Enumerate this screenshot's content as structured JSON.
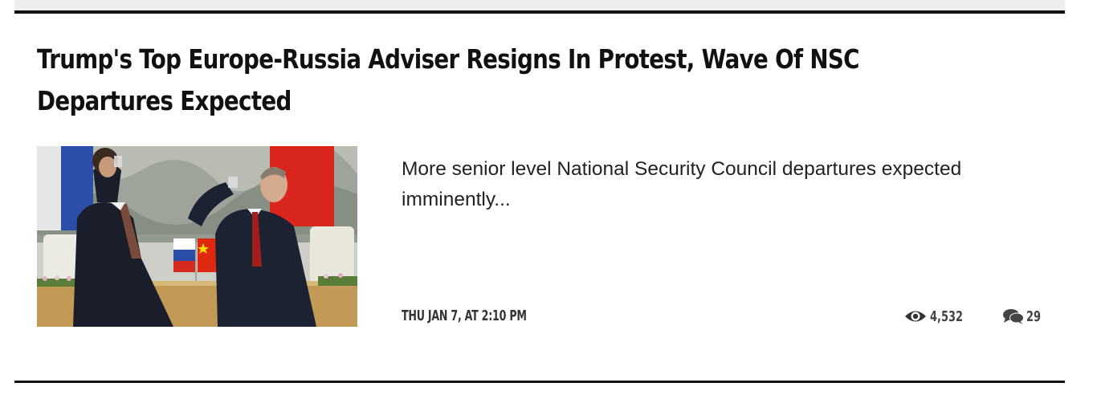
{
  "article": {
    "headline": "Trump's Top Europe-Russia Adviser Resigns In Protest, Wave Of NSC Departures Expected",
    "summary": "More senior level National Security Council departures expected imminently...",
    "date": "THU JAN 7, AT 2:10 PM",
    "views": "4,532",
    "comments": "29"
  },
  "icons": {
    "views": "eye-icon",
    "comments": "comments-icon"
  },
  "colors": {
    "text": "#111111",
    "meta": "#333333",
    "rule": "#111111",
    "top_bar": "#eeeeee"
  }
}
